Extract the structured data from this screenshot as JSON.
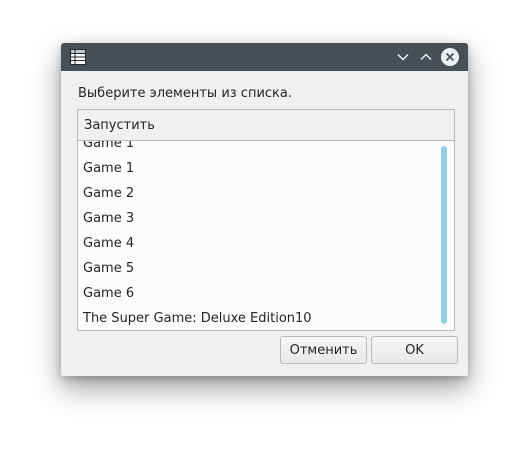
{
  "window": {
    "icon": "list-table-icon",
    "controls": [
      "minimize-chevron-icon",
      "maximize-chevron-icon",
      "close-icon"
    ]
  },
  "dialog": {
    "prompt": "Выберите элементы из списка.",
    "column_header": "Запустить",
    "items": [
      "Game 1",
      "Game 1",
      "Game 2",
      "Game 3",
      "Game 4",
      "Game 5",
      "Game 6",
      "The Super Game: Deluxe Edition10"
    ],
    "cancel_label": "Отменить",
    "ok_label": "OK"
  },
  "colors": {
    "titlebar": "#475057",
    "window_bg": "#eff0f1",
    "list_bg": "#fcfcfc",
    "scrollbar": "#93cee9",
    "text": "#232627"
  }
}
